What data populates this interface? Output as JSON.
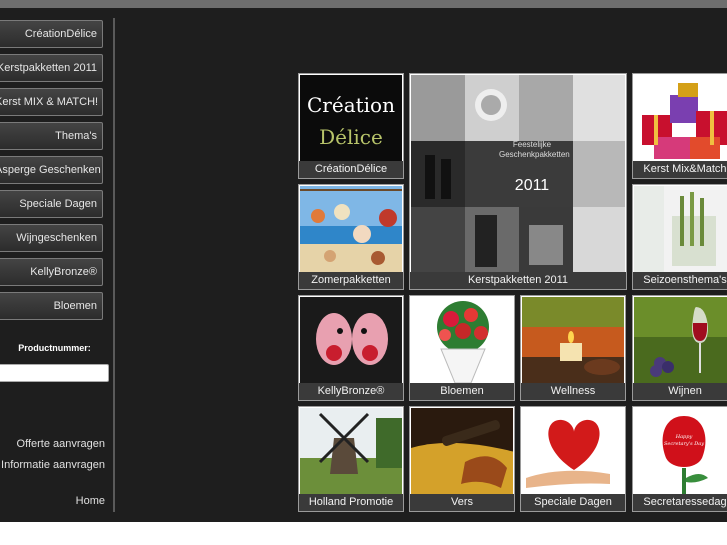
{
  "sidebar": {
    "nav": [
      "CréationDélice",
      "Kerstpakketten 2011",
      "Kerst MIX & MATCH!",
      "Thema's",
      "Asperge Geschenken",
      "Speciale Dagen",
      "Wijngeschenken",
      "KellyBronze®",
      "Bloemen"
    ],
    "product_label": "Productnummer:",
    "links": [
      "Offerte aanvragen",
      "Informatie aanvragen",
      "Home"
    ]
  },
  "tiles": {
    "creation": {
      "caption": "CréationDélice",
      "logo_line1": "Création",
      "logo_line2": "Délice"
    },
    "kerst2011": {
      "caption": "Kerstpakketten 2011",
      "title": "Feestelijke Geschenkpakketten",
      "year": "2011"
    },
    "kerstmix": {
      "caption": "Kerst Mix&Match"
    },
    "zomer": {
      "caption": "Zomerpakketten"
    },
    "seizoen": {
      "caption": "Seizoensthema's"
    },
    "kelly": {
      "caption": "KellyBronze®"
    },
    "bloemen": {
      "caption": "Bloemen"
    },
    "wellness": {
      "caption": "Wellness"
    },
    "wijnen": {
      "caption": "Wijnen"
    },
    "holland": {
      "caption": "Holland Promotie"
    },
    "vers": {
      "caption": "Vers"
    },
    "speciale": {
      "caption": "Speciale Dagen"
    },
    "secretaresse": {
      "caption": "Secretaressedag",
      "card_text": "Happy Secretary's Day"
    }
  }
}
